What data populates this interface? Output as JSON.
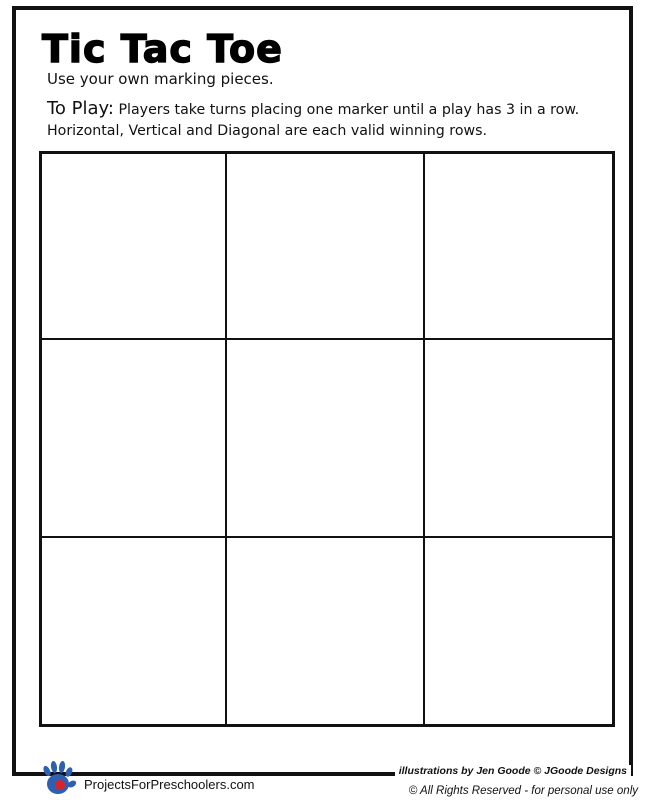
{
  "worksheet": {
    "title": "Tic Tac Toe",
    "subtitle": "Use your own marking pieces.",
    "rules_label": "To Play:",
    "rules_line1": "Players take turns placing one marker until a play has 3 in a row.",
    "rules_line2": "Horizontal, Vertical and Diagonal are each valid winning rows."
  },
  "board": {
    "rows": 3,
    "columns": 3,
    "cells": [
      "",
      "",
      "",
      "",
      "",
      "",
      "",
      "",
      ""
    ]
  },
  "footer": {
    "logo_text": "ProjectsForPreschoolers.com",
    "logo_icon": "handprint-icon",
    "credit": "illustrations by Jen Goode © JGoode Designs",
    "copyright": "© All Rights Reserved - for personal use only"
  },
  "colors": {
    "ink": "#111111",
    "logo_blue": "#2f5fb0",
    "logo_red": "#d8232a"
  }
}
